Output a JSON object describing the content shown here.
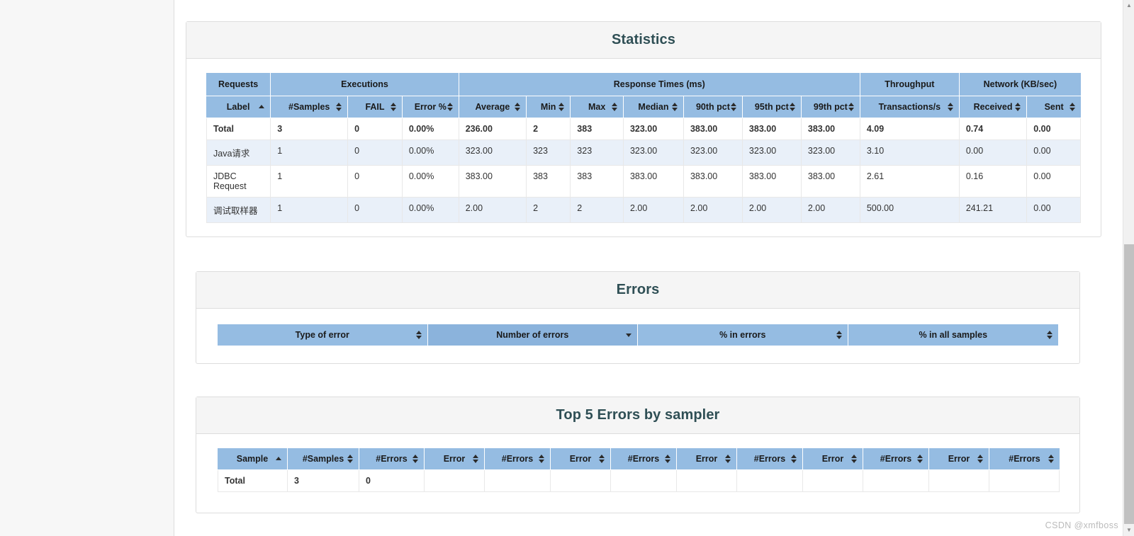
{
  "watermark": "CSDN @xmfboss",
  "statistics": {
    "title": "Statistics",
    "group_headers": [
      {
        "label": "Requests",
        "span": 1
      },
      {
        "label": "Executions",
        "span": 3
      },
      {
        "label": "Response Times (ms)",
        "span": 7
      },
      {
        "label": "Throughput",
        "span": 1
      },
      {
        "label": "Network (KB/sec)",
        "span": 2
      }
    ],
    "columns": [
      {
        "label": "Label",
        "sort": "asc"
      },
      {
        "label": "#Samples",
        "sort": "both"
      },
      {
        "label": "FAIL",
        "sort": "both"
      },
      {
        "label": "Error %",
        "sort": "both"
      },
      {
        "label": "Average",
        "sort": "both"
      },
      {
        "label": "Min",
        "sort": "both"
      },
      {
        "label": "Max",
        "sort": "both"
      },
      {
        "label": "Median",
        "sort": "both"
      },
      {
        "label": "90th pct",
        "sort": "both"
      },
      {
        "label": "95th pct",
        "sort": "both"
      },
      {
        "label": "99th pct",
        "sort": "both"
      },
      {
        "label": "Transactions/s",
        "sort": "both"
      },
      {
        "label": "Received",
        "sort": "both"
      },
      {
        "label": "Sent",
        "sort": "both"
      }
    ],
    "rows": [
      {
        "total": true,
        "cells": [
          "Total",
          "3",
          "0",
          "0.00%",
          "236.00",
          "2",
          "383",
          "323.00",
          "383.00",
          "383.00",
          "383.00",
          "4.09",
          "0.74",
          "0.00"
        ]
      },
      {
        "total": false,
        "cells": [
          "Java请求",
          "1",
          "0",
          "0.00%",
          "323.00",
          "323",
          "323",
          "323.00",
          "323.00",
          "323.00",
          "323.00",
          "3.10",
          "0.00",
          "0.00"
        ]
      },
      {
        "total": false,
        "cells": [
          "JDBC Request",
          "1",
          "0",
          "0.00%",
          "383.00",
          "383",
          "383",
          "383.00",
          "383.00",
          "383.00",
          "383.00",
          "2.61",
          "0.16",
          "0.00"
        ]
      },
      {
        "total": false,
        "cells": [
          "调试取样器",
          "1",
          "0",
          "0.00%",
          "2.00",
          "2",
          "2",
          "2.00",
          "2.00",
          "2.00",
          "2.00",
          "500.00",
          "241.21",
          "0.00"
        ]
      }
    ]
  },
  "errors": {
    "title": "Errors",
    "columns": [
      {
        "label": "Type of error",
        "sort": "both",
        "sorted": false
      },
      {
        "label": "Number of errors",
        "sort": "desc",
        "sorted": true
      },
      {
        "label": "% in errors",
        "sort": "both",
        "sorted": false
      },
      {
        "label": "% in all samples",
        "sort": "both",
        "sorted": false
      }
    ],
    "rows": []
  },
  "top5": {
    "title": "Top 5 Errors by sampler",
    "columns": [
      {
        "label": "Sample",
        "sort": "asc"
      },
      {
        "label": "#Samples",
        "sort": "both"
      },
      {
        "label": "#Errors",
        "sort": "both"
      },
      {
        "label": "Error",
        "sort": "both"
      },
      {
        "label": "#Errors",
        "sort": "both"
      },
      {
        "label": "Error",
        "sort": "both"
      },
      {
        "label": "#Errors",
        "sort": "both"
      },
      {
        "label": "Error",
        "sort": "both"
      },
      {
        "label": "#Errors",
        "sort": "both"
      },
      {
        "label": "Error",
        "sort": "both"
      },
      {
        "label": "#Errors",
        "sort": "both"
      },
      {
        "label": "Error",
        "sort": "both"
      },
      {
        "label": "#Errors",
        "sort": "both"
      }
    ],
    "rows": [
      {
        "total": true,
        "cells": [
          "Total",
          "3",
          "0",
          "",
          "",
          "",
          "",
          "",
          "",
          "",
          "",
          "",
          ""
        ]
      }
    ]
  },
  "colors": {
    "header_blue": "#95bce2",
    "header_blue_sorted": "#8bb3dc",
    "row_alt": "#e9f0f9",
    "title": "#2f4f55",
    "panel_heading_bg": "#f5f5f5",
    "border": "#dddddd"
  }
}
